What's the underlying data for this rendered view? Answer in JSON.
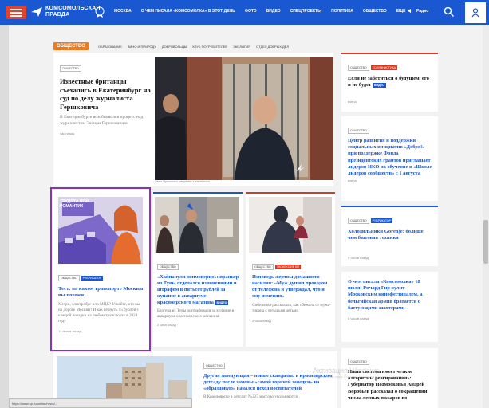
{
  "header": {
    "logo_text": "КОМСОМОЛЬСКАЯ ПРАВДА",
    "nav": [
      "Москва",
      "О чем писала «Комсомолка» в этот день",
      "Фото",
      "Видео",
      "Спецпроекты",
      "Политика",
      "Общество"
    ],
    "nav_more": "Еще",
    "radio_label": "Радио"
  },
  "section": {
    "tag": "Общество",
    "subnav": [
      "Образование",
      "Вино и природу",
      "Добровольцы",
      "Клуб потребителей",
      "Экология",
      "Отдел добрых дел"
    ]
  },
  "lead_article": {
    "tag": "Общество",
    "title": "Известные британцы съехались в Екатеринбург на суд по делу журналиста Гершковича",
    "lead": "В Екатеринбурге возобновился процесс над журналистом Эваном Гершковичем",
    "time": "час назад",
    "photo_caption": "Эван Гершкович уверенно в заседании"
  },
  "right_cards": [
    {
      "tags": [
        "Общество",
        "Колумнистика"
      ],
      "title": "Если не заботиться о будущем, его и не будет",
      "badge": "Видео",
      "time": "вчера"
    },
    {
      "tags": [
        "Общество"
      ],
      "title": "Центр развития и поддержки социальных инициатив «Добро!» при поддержке Фонда президентских грантов приглашает лидеров НКО на обучение в «Школе лидеров сообществ» с 1 августа",
      "time": "вчера"
    },
    {
      "tags": [
        "Общество",
        "Рубрикатор"
      ],
      "title": "Холодильники Gorenje: больше чем бытовая техника",
      "time": "9 часов назад"
    },
    {
      "tags": [],
      "title": "О чем писала «Комсомолка» 18 июля: Ричард Гир рулит Московским кинофестивалем, а бельгийская армия братается с бастующими шахтерами",
      "time": "6 часов назад"
    },
    {
      "tags": [
        "Общество"
      ],
      "title": "Наша система имеет четкие алгоритмы реагирования»: Губернатор Подмосковья Андрей Воробьёв рассказал о сокращении числа лесных пожаров по"
    }
  ],
  "mid_cards": [
    {
      "tags": [
        "Общество",
        "Рубрикатор"
      ],
      "image_caption": "Трудята или романтик",
      "title": "Тест: на каком транспорте Москвы вы похожи",
      "lead": "Метро, электробус или МЦК? Узнайте, кто вы на дороге Москвы! И как вернуть 15 рублей с каждой поездки на любом транспорте в 2024 году",
      "time": "14 минут назад"
    },
    {
      "tags": [
        "Общество"
      ],
      "title": "«Хайпанули неимоверно»: пранкер из Тувы отделался извинениями и штрафом в пятьсот рублей за купание в аквариуме красноярского магазина",
      "badge": "Видео",
      "lead": "Блогера из Тувы оштрафовали за купание в аквариуме красноярского магазина",
      "time": "2 часа назад"
    },
    {
      "tags": [
        "Общество",
        "Эксклюзив КП"
      ],
      "title": "Исповедь жертвы домашнего насилия: «Муж душил проводом от телефона и утверждал, что я сму изменяю»",
      "lead": "Сибирячка рассказала, как сбежала от мужа-тирана с четырьмя детьми",
      "time": "2 часа назад"
    }
  ],
  "bottom_card": {
    "tags": [
      "Общество"
    ],
    "title": "Другая заведующая – новые скандалы: в красноярском детсаду после замены «самой горячей заведки» на «образцовую» начался исход воспитателей",
    "lead": "В Красноярске в детсаду №227 массово увольняются"
  },
  "status_url": "https://www.kp.ru/online/news/...",
  "watermark": {
    "title": "Активация Windows",
    "sub": "Чтобы активировать Windows, перейдите в раздел \"Параметры\"."
  },
  "colors": {
    "brand": "#1958d0",
    "accent": "#ef7a1d",
    "red": "#d63a22",
    "highlight": "#8b2fc9"
  }
}
